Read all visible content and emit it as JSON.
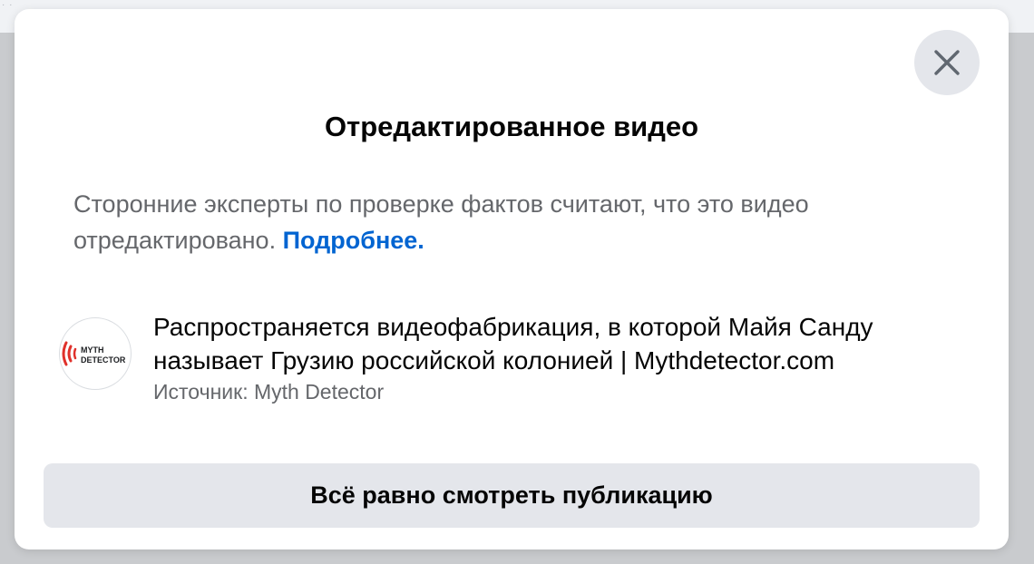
{
  "dialog": {
    "title": "Отредактированное видео",
    "description": "Сторонние эксперты по проверке фактов считают, что это видео отредактировано.",
    "learn_more_link": "Подробнее.",
    "close_icon": "close-icon"
  },
  "source": {
    "logo_text_line1": "MYTH",
    "logo_text_line2": "DETECTOR",
    "logo_icon": "myth-detector-logo",
    "article_title": "Распространяется видеофабрикация, в которой Майя Санду называет Грузию российской колонией | Mythdetector.com",
    "source_line": "Источник: Myth Detector"
  },
  "actions": {
    "view_anyway_label": "Всё равно смотреть публикацию"
  },
  "colors": {
    "link": "#0064d1",
    "logo_red": "#e0312b",
    "button_bg": "#e4e6eb"
  }
}
